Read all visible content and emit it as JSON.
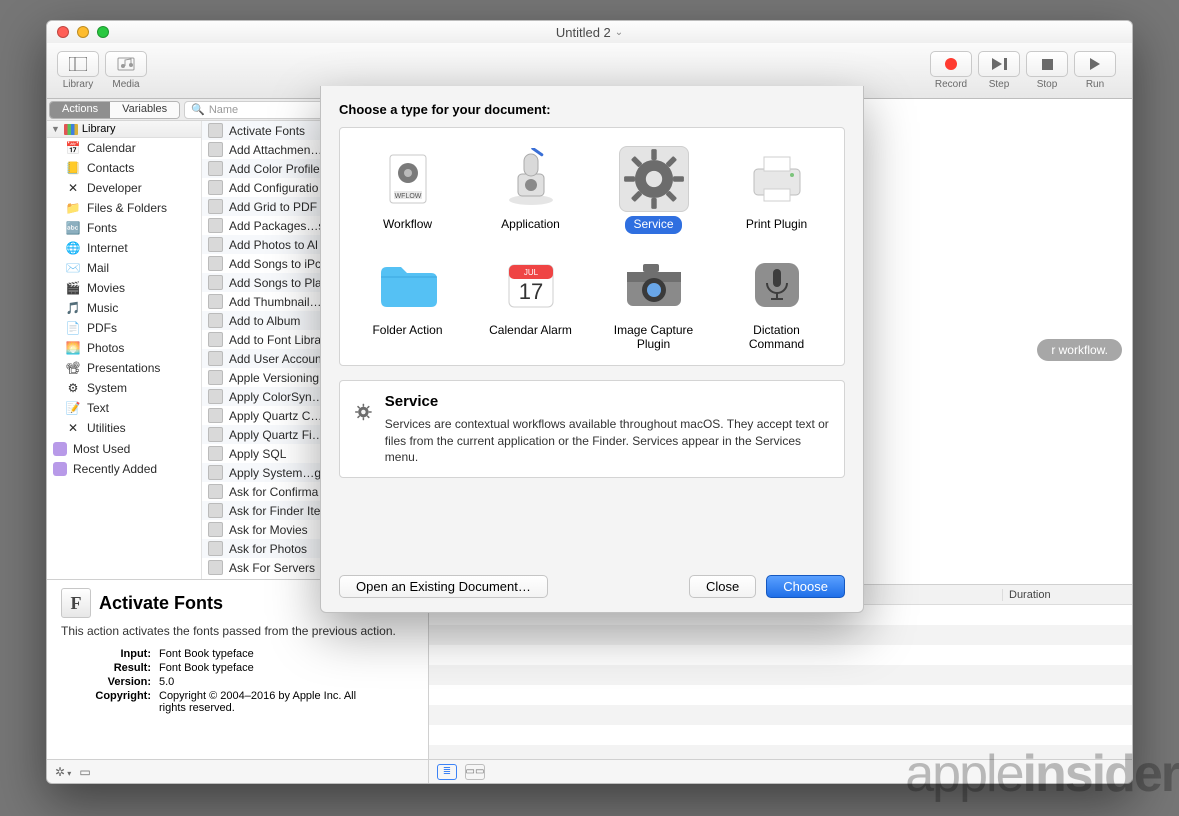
{
  "window": {
    "title": "Untitled 2"
  },
  "toolbar": {
    "library": "Library",
    "media": "Media",
    "record": "Record",
    "step": "Step",
    "stop": "Stop",
    "run": "Run"
  },
  "segments": {
    "actions": "Actions",
    "variables": "Variables"
  },
  "search": {
    "placeholder": "Name"
  },
  "library": {
    "header": "Library",
    "categories": [
      {
        "label": "Calendar",
        "icon": "📅"
      },
      {
        "label": "Contacts",
        "icon": "📒"
      },
      {
        "label": "Developer",
        "icon": "✕"
      },
      {
        "label": "Files & Folders",
        "icon": "📁"
      },
      {
        "label": "Fonts",
        "icon": "🔤"
      },
      {
        "label": "Internet",
        "icon": "🌐"
      },
      {
        "label": "Mail",
        "icon": "✉️"
      },
      {
        "label": "Movies",
        "icon": "🎬"
      },
      {
        "label": "Music",
        "icon": "🎵"
      },
      {
        "label": "PDFs",
        "icon": "📄"
      },
      {
        "label": "Photos",
        "icon": "🌅"
      },
      {
        "label": "Presentations",
        "icon": "📽"
      },
      {
        "label": "System",
        "icon": "⚙"
      },
      {
        "label": "Text",
        "icon": "📝"
      },
      {
        "label": "Utilities",
        "icon": "✕"
      }
    ],
    "smart": [
      {
        "label": "Most Used"
      },
      {
        "label": "Recently Added"
      }
    ]
  },
  "actions": [
    "Activate Fonts",
    "Add Attachmen…",
    "Add Color Profile",
    "Add Configuratio",
    "Add Grid to PDF",
    "Add Packages…s",
    "Add Photos to Al",
    "Add Songs to iPc",
    "Add Songs to Pla",
    "Add Thumbnail…",
    "Add to Album",
    "Add to Font Libra",
    "Add User Accoun",
    "Apple Versioning",
    "Apply ColorSyn…",
    "Apply Quartz C…",
    "Apply Quartz Fi…",
    "Apply SQL",
    "Apply System…g",
    "Ask for Confirma",
    "Ask for Finder Ite",
    "Ask for Movies",
    "Ask for Photos",
    "Ask For Servers"
  ],
  "info": {
    "title": "Activate Fonts",
    "desc": "This action activates the fonts passed from the previous action.",
    "input_k": "Input:",
    "input_v": "Font Book typeface",
    "result_k": "Result:",
    "result_v": "Font Book typeface",
    "version_k": "Version:",
    "version_v": "5.0",
    "copyright_k": "Copyright:",
    "copyright_v": "Copyright © 2004–2016 by Apple Inc. All rights reserved."
  },
  "canvas": {
    "hint": "r workflow."
  },
  "log": {
    "col1": "",
    "col2": "Duration"
  },
  "sheet": {
    "heading": "Choose a type for your document:",
    "types": [
      {
        "label": "Workflow"
      },
      {
        "label": "Application"
      },
      {
        "label": "Service"
      },
      {
        "label": "Print Plugin"
      },
      {
        "label": "Folder Action"
      },
      {
        "label": "Calendar Alarm"
      },
      {
        "label": "Image Capture Plugin"
      },
      {
        "label": "Dictation Command"
      }
    ],
    "desc_title": "Service",
    "desc_body": "Services are contextual workflows available throughout macOS. They accept text or files from the current application or the Finder. Services appear in the Services menu.",
    "open": "Open an Existing Document…",
    "close": "Close",
    "choose": "Choose"
  },
  "watermark": {
    "a": "apple",
    "b": "insider"
  }
}
